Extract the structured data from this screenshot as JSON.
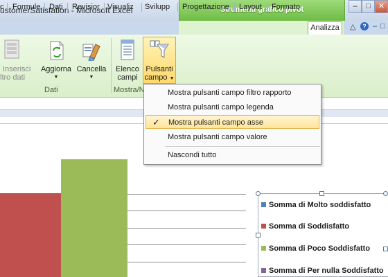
{
  "window": {
    "title": "ustomerSatisfation  -  Microsoft Excel",
    "context_header": "Strumenti grafico pivot"
  },
  "tabs": [
    "c",
    "Formule",
    "Dati",
    "Revisior",
    "Visualiz",
    "Svilupp",
    "Progettazione",
    "Layout",
    "Formato",
    "Analizza"
  ],
  "ribbon": {
    "inserisci": [
      "Inserisci",
      "ltro dati"
    ],
    "aggiorna": "Aggiorna",
    "cancella": "Cancella",
    "group_dati": "Dati",
    "elenco": [
      "Elenco",
      "campi"
    ],
    "pulsanti": [
      "Pulsanti",
      "campo"
    ],
    "group_mostra": "Mostra/N"
  },
  "menu": {
    "items": [
      "Mostra pulsanti campo filtro rapporto",
      "Mostra pulsanti campo legenda",
      "Mostra pulsanti campo asse",
      "Mostra pulsanti campo valore",
      "Nascondi tutto"
    ],
    "checked_item": "Mostra pulsanti campo asse"
  },
  "chart_data": {
    "type": "bar",
    "series": [
      {
        "name": "Somma di Molto soddisfatto",
        "color": "#4f81bd"
      },
      {
        "name": "Somma di Soddisfatto",
        "color": "#c0504d"
      },
      {
        "name": "Somma di Poco Soddisfatto",
        "color": "#9bbb59"
      },
      {
        "name": "Somma di Per nulla Soddisfatto",
        "color": "#8064a2"
      }
    ]
  }
}
